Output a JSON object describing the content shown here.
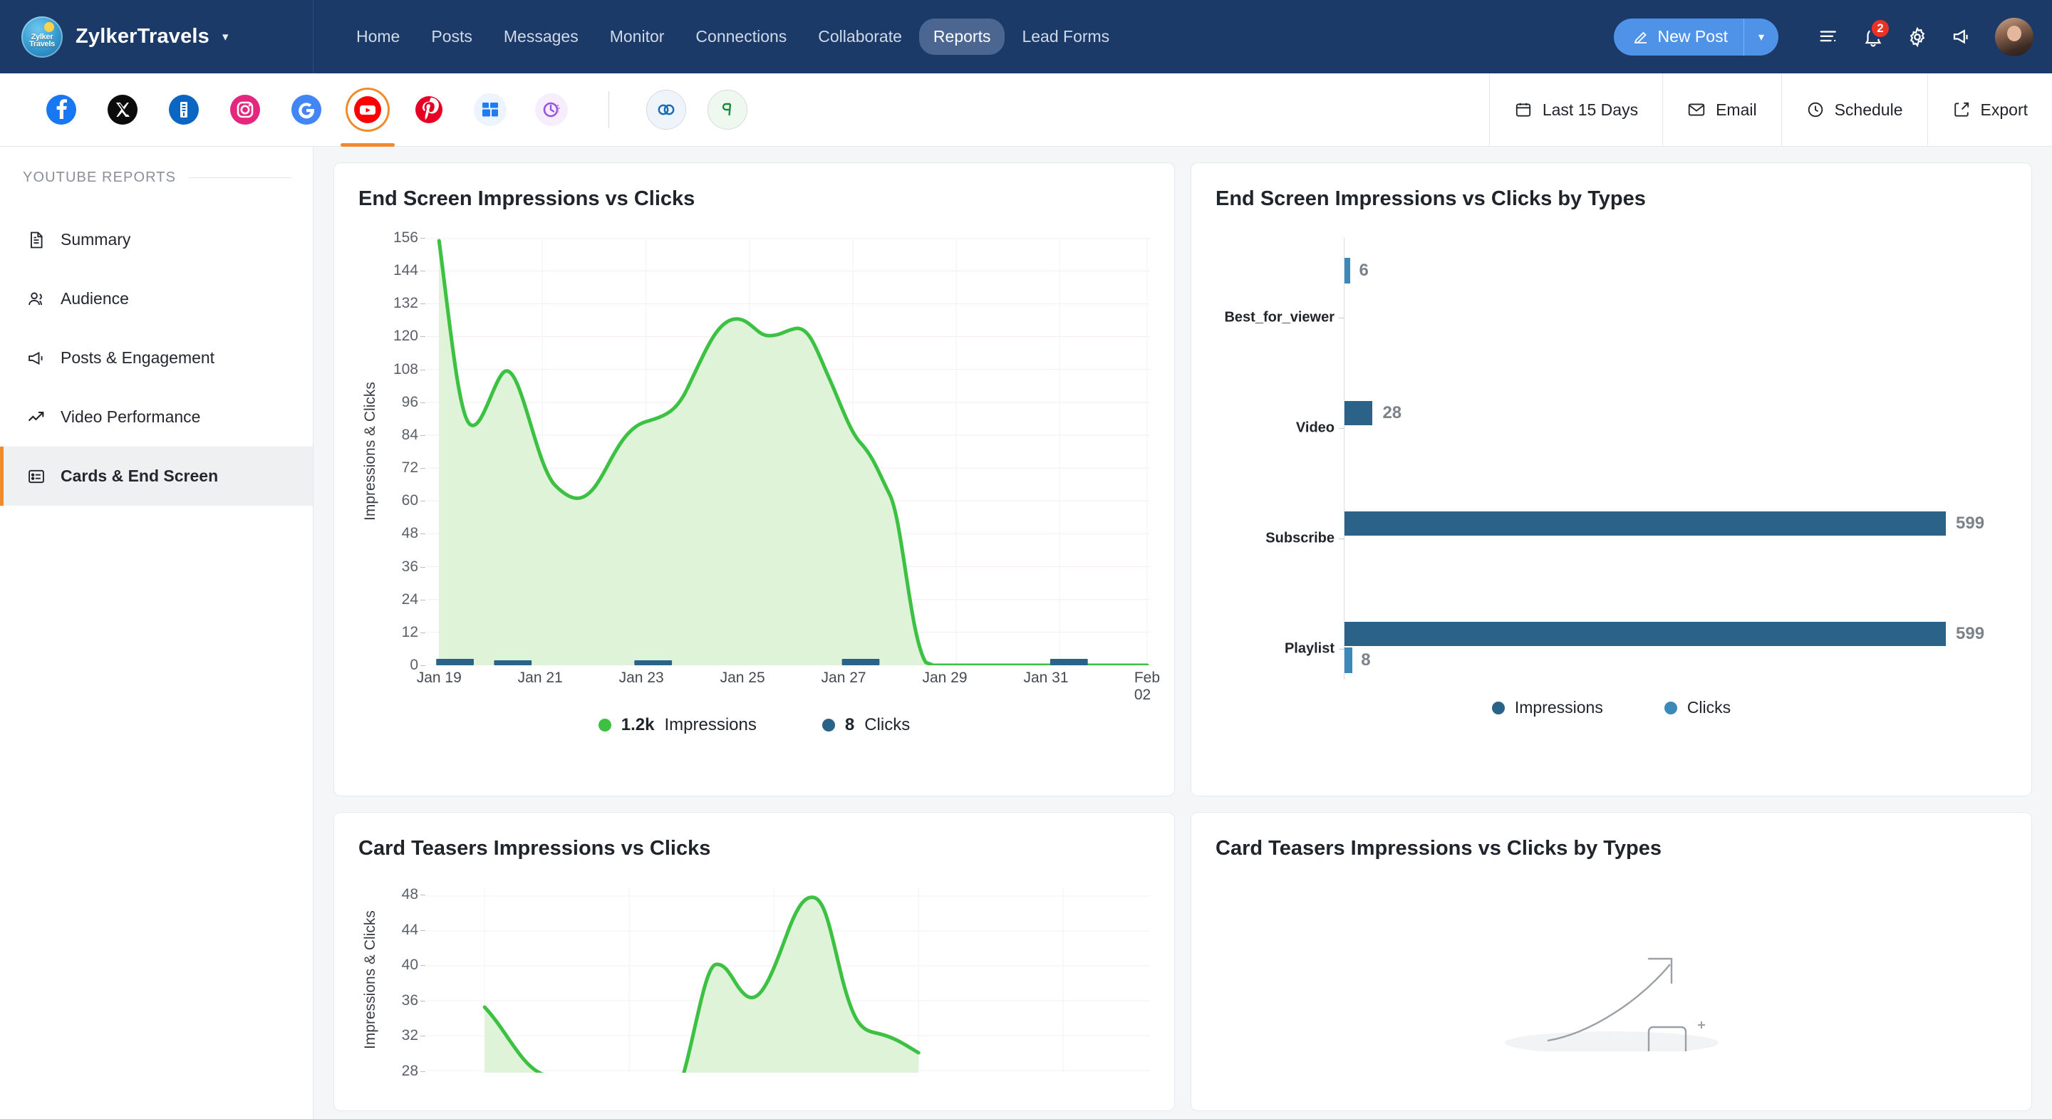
{
  "topbar": {
    "brand": "ZylkerTravels",
    "brand_caret": "chevron-down",
    "nav": [
      {
        "label": "Home",
        "active": false
      },
      {
        "label": "Posts",
        "active": false
      },
      {
        "label": "Messages",
        "active": false
      },
      {
        "label": "Monitor",
        "active": false
      },
      {
        "label": "Connections",
        "active": false
      },
      {
        "label": "Collaborate",
        "active": false
      },
      {
        "label": "Reports",
        "active": true
      },
      {
        "label": "Lead Forms",
        "active": false
      }
    ],
    "new_post_label": "New Post",
    "notification_count": "2",
    "accent": "#4f93e8",
    "bg": "#1b3a68"
  },
  "channels": {
    "items": [
      {
        "name": "facebook",
        "selected": false
      },
      {
        "name": "x-twitter",
        "selected": false
      },
      {
        "name": "linkedin",
        "selected": false
      },
      {
        "name": "instagram",
        "selected": false
      },
      {
        "name": "google-business",
        "selected": false
      },
      {
        "name": "youtube",
        "selected": true
      },
      {
        "name": "pinterest",
        "selected": false
      },
      {
        "name": "bluesky",
        "selected": false
      },
      {
        "name": "mastodon",
        "selected": false
      }
    ],
    "extra": [
      {
        "name": "zoho-crm-link"
      },
      {
        "name": "zoho-desk"
      }
    ]
  },
  "toolbar": {
    "date_range": "Last 15 Days",
    "email": "Email",
    "schedule": "Schedule",
    "export": "Export"
  },
  "sidebar": {
    "heading": "YOUTUBE REPORTS",
    "items": [
      {
        "label": "Summary",
        "icon": "document-icon",
        "active": false
      },
      {
        "label": "Audience",
        "icon": "users-icon",
        "active": false
      },
      {
        "label": "Posts & Engagement",
        "icon": "megaphone-icon",
        "active": false
      },
      {
        "label": "Video Performance",
        "icon": "trending-up-icon",
        "active": false
      },
      {
        "label": "Cards & End Screen",
        "icon": "card-list-icon",
        "active": true
      }
    ]
  },
  "cards": {
    "end_screen_line": "End Screen Impressions vs Clicks",
    "end_screen_types": "End Screen Impressions vs Clicks by Types",
    "card_teasers_line": "Card Teasers Impressions vs Clicks",
    "card_teasers_types": "Card Teasers Impressions vs Clicks by Types"
  },
  "chart_data": [
    {
      "id": "end-screen-impressions-vs-clicks",
      "type": "area",
      "title": "End Screen Impressions vs Clicks",
      "xlabel": "",
      "ylabel": "Impressions & Clicks",
      "ylim": [
        0,
        156
      ],
      "yticks": [
        0,
        12,
        24,
        36,
        48,
        60,
        72,
        84,
        96,
        108,
        120,
        132,
        144,
        156
      ],
      "xticks": [
        "Jan 19",
        "Jan 21",
        "Jan 23",
        "Jan 25",
        "Jan 27",
        "Jan 29",
        "Jan 31",
        "Feb 02"
      ],
      "x": [
        "Jan 18",
        "Jan 19",
        "Jan 20",
        "Jan 21",
        "Jan 22",
        "Jan 23",
        "Jan 24",
        "Jan 25",
        "Jan 26",
        "Jan 27",
        "Jan 28",
        "Jan 29",
        "Jan 30",
        "Jan 31",
        "Feb 01",
        "Feb 02"
      ],
      "grid": true,
      "legend_position": "bottom",
      "series": [
        {
          "name": "Impressions",
          "total_label": "1.2k",
          "color": "#3cc142",
          "values": [
            157,
            88,
            110,
            74,
            70,
            85,
            92,
            112,
            128,
            122,
            124,
            105,
            92,
            0,
            0,
            0
          ]
        },
        {
          "name": "Clicks",
          "total_label": "8",
          "color": "#2b6288",
          "values": [
            1,
            1,
            0,
            1,
            0,
            0,
            0,
            1,
            0,
            1,
            1,
            1,
            1,
            0,
            0,
            0
          ]
        }
      ]
    },
    {
      "id": "end-screen-impressions-vs-clicks-by-types",
      "type": "bar",
      "orientation": "horizontal",
      "title": "End Screen Impressions vs Clicks by Types",
      "categories": [
        "Best_for_viewer",
        "Video",
        "Subscribe",
        "Playlist"
      ],
      "xlim": [
        0,
        660
      ],
      "grid": false,
      "legend_position": "bottom",
      "series": [
        {
          "name": "Impressions",
          "color": "#2b6288",
          "values": [
            0,
            28,
            599,
            599
          ]
        },
        {
          "name": "Clicks",
          "color": "#3a89b8",
          "values": [
            6,
            0,
            0,
            8
          ]
        }
      ],
      "bar_labels": [
        {
          "category": "Best_for_viewer",
          "series": "Clicks",
          "value": 6,
          "text": "6"
        },
        {
          "category": "Video",
          "series": "Impressions",
          "value": 28,
          "text": "28"
        },
        {
          "category": "Subscribe",
          "series": "Impressions",
          "value": 599,
          "text": "599"
        },
        {
          "category": "Playlist",
          "series": "Impressions",
          "value": 599,
          "text": "599"
        },
        {
          "category": "Playlist",
          "series": "Clicks",
          "value": 8,
          "text": "8"
        }
      ]
    },
    {
      "id": "card-teasers-impressions-vs-clicks",
      "type": "area",
      "title": "Card Teasers Impressions vs Clicks",
      "ylabel": "Impressions & Clicks",
      "yticks": [
        28,
        32,
        36,
        40,
        44,
        48
      ],
      "ylim": [
        28,
        48
      ],
      "grid": true,
      "series": [
        {
          "name": "Impressions",
          "color": "#3cc142",
          "values": [
            35,
            27,
            26,
            28,
            40,
            35,
            48,
            31,
            30
          ]
        }
      ]
    },
    {
      "id": "card-teasers-impressions-vs-clicks-by-types",
      "type": "empty",
      "title": "Card Teasers Impressions vs Clicks by Types"
    }
  ]
}
